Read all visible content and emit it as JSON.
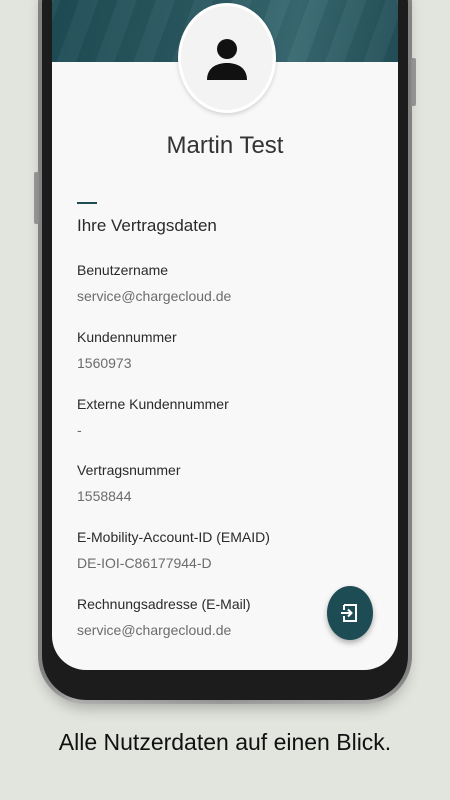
{
  "profile": {
    "name": "Martin Test"
  },
  "section": {
    "title": "Ihre Vertragsdaten"
  },
  "fields": [
    {
      "label": "Benutzername",
      "value": "service@chargecloud.de"
    },
    {
      "label": "Kundennummer",
      "value": "1560973"
    },
    {
      "label": "Externe Kundennummer",
      "value": "-"
    },
    {
      "label": "Vertragsnummer",
      "value": "1558844"
    },
    {
      "label": "E-Mobility-Account-ID (EMAID)",
      "value": "DE-IOI-C86177944-D"
    },
    {
      "label": "Rechnungsadresse (E-Mail)",
      "value": "service@chargecloud.de"
    }
  ],
  "caption": "Alle Nutzerdaten auf einen Blick.",
  "icons": {
    "avatar": "person-icon",
    "fab": "logout-icon"
  },
  "colors": {
    "accent": "#1e4c55",
    "background": "#e2e4de"
  }
}
